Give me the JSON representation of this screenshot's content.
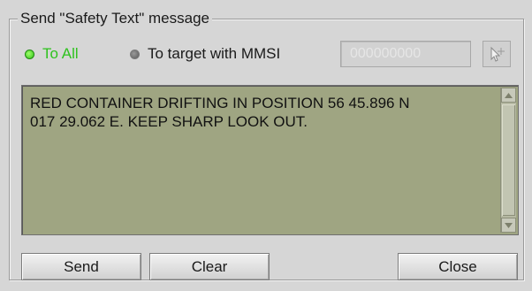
{
  "dialog": {
    "title": "Send \"Safety Text\" message"
  },
  "recipients": {
    "to_all_label": "To All",
    "to_target_label": "To target with MMSI",
    "selected": "to_all"
  },
  "mmsi": {
    "value": "000000000"
  },
  "icons": {
    "pick_target": "cursor-target-icon",
    "scroll_up": "scroll-up-arrow-icon",
    "scroll_down": "scroll-down-arrow-icon"
  },
  "message": {
    "text": "RED CONTAINER DRIFTING IN POSITION 56 45.896 N\n017 29.062 E. KEEP SHARP LOOK OUT."
  },
  "buttons": {
    "send": "Send",
    "clear": "Clear",
    "close": "Close"
  },
  "colors": {
    "active_radio": "#2ec21e",
    "message_bg": "#9fa582"
  }
}
